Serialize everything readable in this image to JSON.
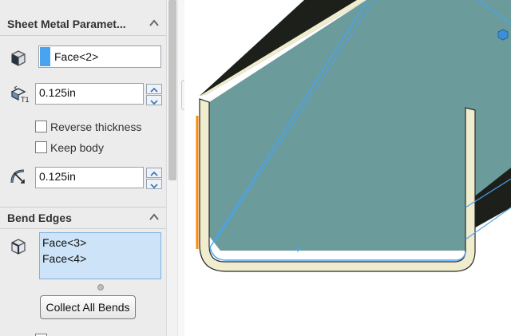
{
  "sheet_metal": {
    "title": "Sheet Metal Paramet...",
    "face_value": "Face<2>",
    "thickness_value": "0.125in",
    "reverse_thickness_label": "Reverse thickness",
    "keep_body_label": "Keep body",
    "radius_value": "0.125in"
  },
  "bend_edges": {
    "title": "Bend Edges",
    "list": [
      "Face<3>",
      "Face<4>"
    ],
    "collect_button": "Collect All Bends"
  },
  "icons": [
    "cube-face-icon",
    "thickness-icon",
    "spin-up-icon",
    "spin-down-icon",
    "bend-radius-icon",
    "collapse-chevron-icon",
    "edge-select-icon"
  ],
  "colors": {
    "list_selected_bg": "#cde3f7",
    "selection_accent": "#4aa3f0",
    "model_fill": "#6b9b9b",
    "model_edge": "#f0ecce",
    "highlight_edge": "#ff8a00"
  }
}
